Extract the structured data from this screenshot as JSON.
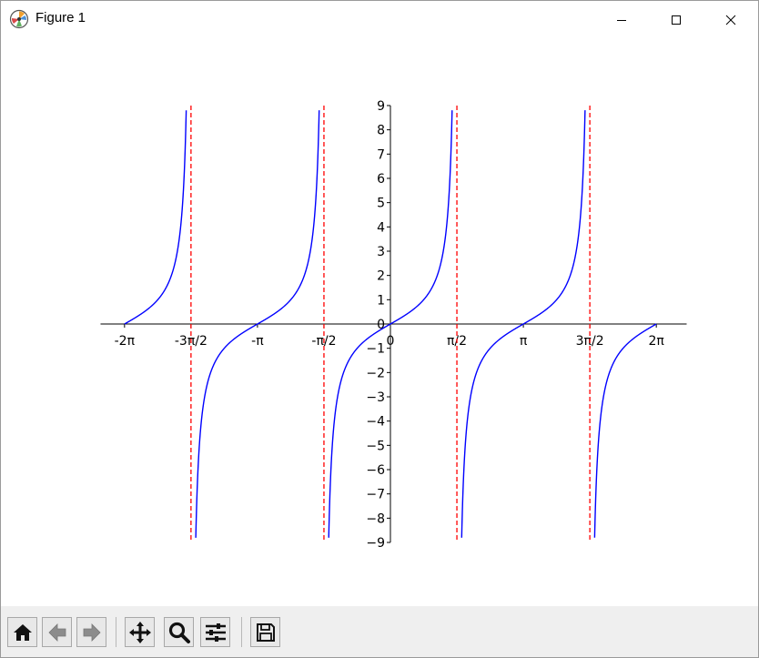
{
  "window": {
    "title": "Figure 1"
  },
  "toolbar": {
    "buttons": [
      "home-icon",
      "back-arrow-icon",
      "forward-arrow-icon",
      "pan-icon",
      "zoom-icon",
      "subplots-config-icon",
      "save-icon"
    ]
  },
  "chart_data": {
    "type": "line",
    "function": "tan(x)",
    "xlim": [
      -6.85,
      7.0
    ],
    "ylim": [
      -9,
      9
    ],
    "series": [
      {
        "color": "#0000ff",
        "style": "solid",
        "x_range": [
          -6.2832,
          6.2832
        ],
        "y_clip": [
          -9,
          9
        ]
      }
    ],
    "asymptotes": {
      "x": [
        -4.7124,
        -1.5708,
        1.5708,
        4.7124
      ],
      "color": "#ff0000",
      "style": "dashed"
    },
    "x_ticks": [
      {
        "value": -6.2832,
        "label": "-2π"
      },
      {
        "value": -4.7124,
        "label": "-3π/2"
      },
      {
        "value": -3.1416,
        "label": "-π"
      },
      {
        "value": -1.5708,
        "label": "-π/2"
      },
      {
        "value": 0,
        "label": "0"
      },
      {
        "value": 1.5708,
        "label": "π/2"
      },
      {
        "value": 3.1416,
        "label": "π"
      },
      {
        "value": 4.7124,
        "label": "3π/2"
      },
      {
        "value": 6.2832,
        "label": "2π"
      }
    ],
    "y_ticks": [
      9,
      8,
      7,
      6,
      5,
      4,
      3,
      2,
      1,
      0,
      -1,
      -2,
      -3,
      -4,
      -5,
      -6,
      -7,
      -8,
      -9
    ],
    "spines": "centered at origin"
  }
}
